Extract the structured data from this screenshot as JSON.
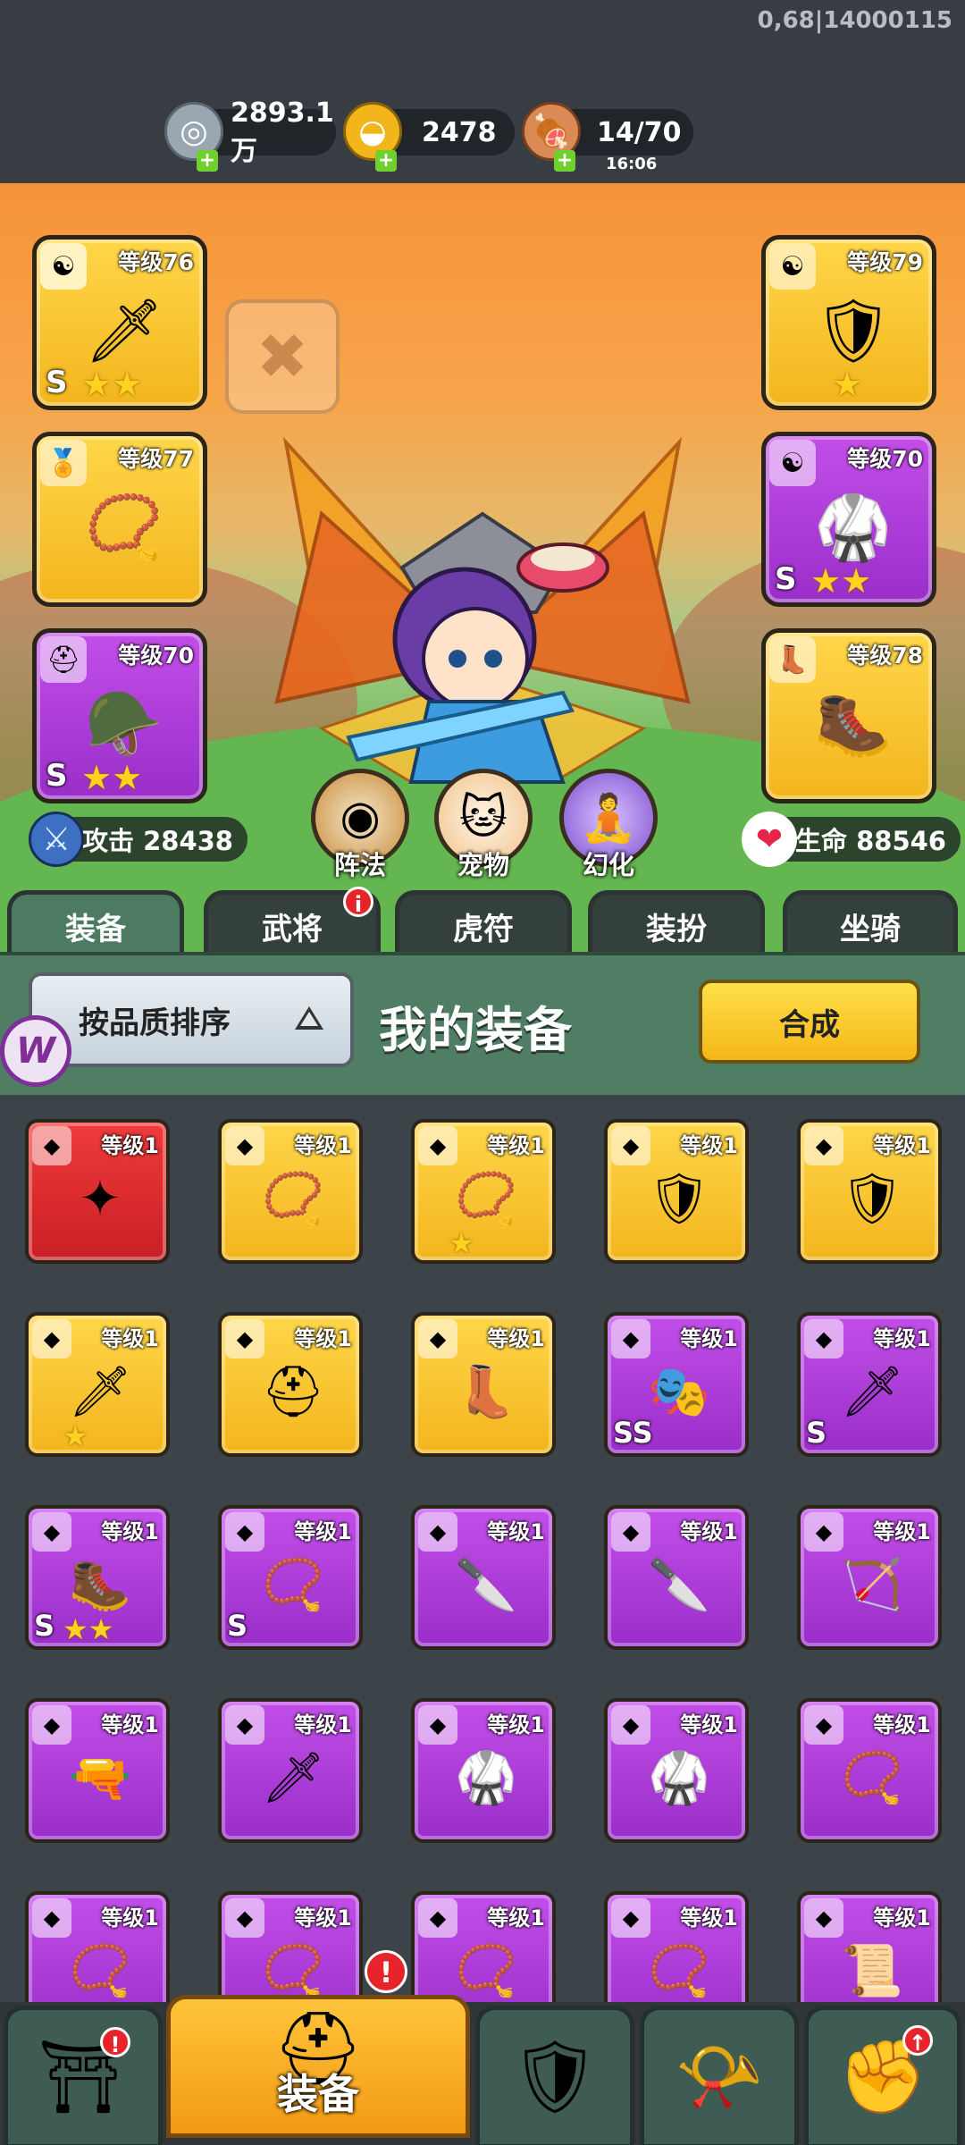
{
  "debug_text": "0,68|14000115",
  "resources": {
    "silver": {
      "value": "2893.1万",
      "icon": "silver-coin-icon"
    },
    "gold": {
      "value": "2478",
      "icon": "gold-ingot-icon"
    },
    "stamina": {
      "value": "14/70",
      "timer": "16:06",
      "icon": "meat-icon"
    }
  },
  "equipped": {
    "left": [
      {
        "level": "等级76",
        "grade": "S",
        "stars": "★★",
        "type": "yin-yang",
        "art": "ice-sword"
      },
      {
        "level": "等级77",
        "grade": "",
        "stars": "",
        "type": "medal",
        "art": "amulet"
      },
      {
        "level": "等级70",
        "grade": "S",
        "stars": "★★",
        "type": "helmet",
        "art": "helmet"
      }
    ],
    "right": [
      {
        "level": "等级79",
        "grade": "",
        "stars": "★",
        "type": "yin-yang",
        "art": "armor"
      },
      {
        "level": "等级70",
        "grade": "S",
        "stars": "★★",
        "type": "yin-yang",
        "art": "armor"
      },
      {
        "level": "等级78",
        "grade": "",
        "stars": "",
        "type": "boot",
        "art": "boots"
      }
    ]
  },
  "hero_buttons": [
    {
      "label": "阵法",
      "icon": "formation-icon"
    },
    {
      "label": "宠物",
      "icon": "pet-cat-icon"
    },
    {
      "label": "幻化",
      "icon": "transform-icon"
    }
  ],
  "stats": {
    "attack": {
      "label": "攻击 28438",
      "icon": "sword-icon"
    },
    "hp": {
      "label": "生命 88546",
      "icon": "heart-icon"
    }
  },
  "tabs": [
    {
      "label": "装备",
      "active": true
    },
    {
      "label": "武将",
      "badge": "i"
    },
    {
      "label": "虎符"
    },
    {
      "label": "装扮"
    },
    {
      "label": "坐骑"
    }
  ],
  "panel": {
    "sort_label": "按品质排序",
    "title": "我的装备",
    "synthesize_label": "合成",
    "logo_letter": "W"
  },
  "inventory": [
    {
      "level": "等级1",
      "color": "red",
      "grade": "",
      "stars": "",
      "art": "✦"
    },
    {
      "level": "等级1",
      "color": "gold",
      "grade": "",
      "stars": "",
      "art": "📿"
    },
    {
      "level": "等级1",
      "color": "gold",
      "grade": "",
      "stars": "★",
      "art": "📿"
    },
    {
      "level": "等级1",
      "color": "gold",
      "grade": "",
      "stars": "",
      "art": "🛡"
    },
    {
      "level": "等级1",
      "color": "gold",
      "grade": "",
      "stars": "",
      "art": "🛡"
    },
    {
      "level": "等级1",
      "color": "gold",
      "grade": "",
      "stars": "★",
      "art": "🗡"
    },
    {
      "level": "等级1",
      "color": "gold",
      "grade": "",
      "stars": "",
      "art": "⛑"
    },
    {
      "level": "等级1",
      "color": "gold",
      "grade": "",
      "stars": "",
      "art": "👢"
    },
    {
      "level": "等级1",
      "color": "purple",
      "grade": "SS",
      "stars": "",
      "art": "🎭"
    },
    {
      "level": "等级1",
      "color": "purple",
      "grade": "S",
      "stars": "",
      "art": "🗡"
    },
    {
      "level": "等级1",
      "color": "purple",
      "grade": "S",
      "stars": "★★",
      "art": "🥾"
    },
    {
      "level": "等级1",
      "color": "purple",
      "grade": "S",
      "stars": "",
      "art": "📿"
    },
    {
      "level": "等级1",
      "color": "purple",
      "grade": "",
      "stars": "",
      "art": "🔪"
    },
    {
      "level": "等级1",
      "color": "purple",
      "grade": "",
      "stars": "",
      "art": "🔪"
    },
    {
      "level": "等级1",
      "color": "purple",
      "grade": "",
      "stars": "",
      "art": "🏹"
    },
    {
      "level": "等级1",
      "color": "purple",
      "grade": "",
      "stars": "",
      "art": "🔫"
    },
    {
      "level": "等级1",
      "color": "purple",
      "grade": "",
      "stars": "",
      "art": "🗡"
    },
    {
      "level": "等级1",
      "color": "purple",
      "grade": "",
      "stars": "",
      "art": "🥋"
    },
    {
      "level": "等级1",
      "color": "purple",
      "grade": "",
      "stars": "",
      "art": "🥋"
    },
    {
      "level": "等级1",
      "color": "purple",
      "grade": "",
      "stars": "",
      "art": "📿"
    },
    {
      "level": "等级1",
      "color": "purple",
      "grade": "",
      "stars": "",
      "art": "📿"
    },
    {
      "level": "等级1",
      "color": "purple",
      "grade": "",
      "stars": "",
      "art": "📿"
    },
    {
      "level": "等级1",
      "color": "purple",
      "grade": "",
      "stars": "",
      "art": "📿"
    },
    {
      "level": "等级1",
      "color": "purple",
      "grade": "",
      "stars": "",
      "art": "📿"
    },
    {
      "level": "等级1",
      "color": "purple",
      "grade": "",
      "stars": "",
      "art": "📜"
    }
  ],
  "bottom_nav": [
    {
      "label": "",
      "icon": "shop-gate-icon",
      "badge": "!"
    },
    {
      "label": "装备",
      "icon": "helmet-icon",
      "active": true,
      "badge": "!"
    },
    {
      "label": "",
      "icon": "battle-shield-icon"
    },
    {
      "label": "",
      "icon": "horn-icon"
    },
    {
      "label": "",
      "icon": "fist-upgrade-icon",
      "badge": "↑"
    }
  ]
}
